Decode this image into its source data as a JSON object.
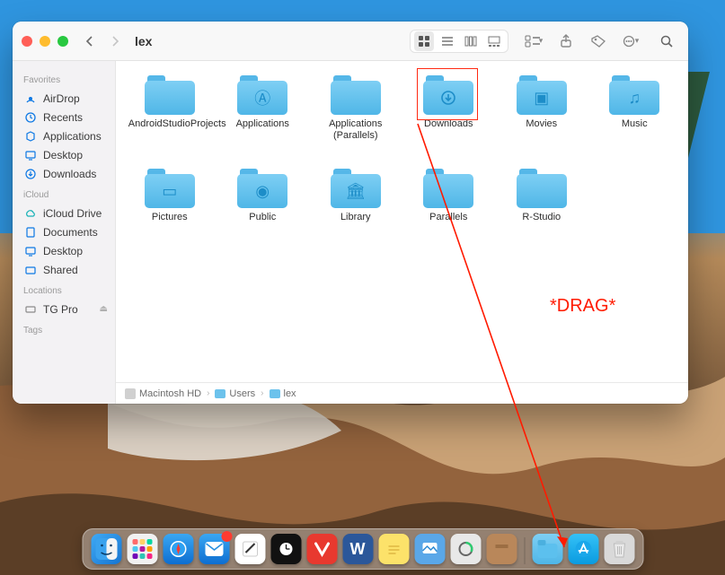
{
  "window": {
    "title": "lex"
  },
  "toolbar": {
    "view_icon_active": "icon",
    "group_label": "Group",
    "share_label": "Share",
    "tags_label": "Tags",
    "more_label": "More",
    "search_label": "Search"
  },
  "sidebar": {
    "sections": [
      {
        "header": "Favorites",
        "items": [
          {
            "label": "AirDrop",
            "icon": "airdrop"
          },
          {
            "label": "Recents",
            "icon": "clock"
          },
          {
            "label": "Applications",
            "icon": "apps"
          },
          {
            "label": "Desktop",
            "icon": "desktop"
          },
          {
            "label": "Downloads",
            "icon": "download"
          }
        ]
      },
      {
        "header": "iCloud",
        "items": [
          {
            "label": "iCloud Drive",
            "icon": "cloud"
          },
          {
            "label": "Documents",
            "icon": "doc"
          },
          {
            "label": "Desktop",
            "icon": "desktop"
          },
          {
            "label": "Shared",
            "icon": "shared"
          }
        ]
      },
      {
        "header": "Locations",
        "items": [
          {
            "label": "TG Pro",
            "icon": "disk",
            "eject": true
          }
        ]
      },
      {
        "header": "Tags",
        "items": []
      }
    ]
  },
  "folders": [
    {
      "label": "AndroidStudioProjects",
      "glyph": ""
    },
    {
      "label": "Applications",
      "glyph": "A"
    },
    {
      "label": "Applications (Parallels)",
      "glyph": ""
    },
    {
      "label": "Downloads",
      "glyph": "↓",
      "highlight": true
    },
    {
      "label": "Movies",
      "glyph": "▷"
    },
    {
      "label": "Music",
      "glyph": "♫"
    },
    {
      "label": "Pictures",
      "glyph": "▣"
    },
    {
      "label": "Public",
      "glyph": "◉"
    },
    {
      "label": "Library",
      "glyph": "🏛"
    },
    {
      "label": "Parallels",
      "glyph": ""
    },
    {
      "label": "R-Studio",
      "glyph": ""
    }
  ],
  "pathbar": {
    "segments": [
      {
        "label": "Macintosh HD",
        "type": "hdd"
      },
      {
        "label": "Users",
        "type": "folder"
      },
      {
        "label": "lex",
        "type": "folder"
      }
    ]
  },
  "dock": {
    "apps": [
      {
        "name": "Finder",
        "class": "d-finder"
      },
      {
        "name": "Launchpad",
        "class": "d-launchpad"
      },
      {
        "name": "Safari",
        "class": "d-safari"
      },
      {
        "name": "Mail",
        "class": "d-mail"
      },
      {
        "name": "TextEdit",
        "class": "d-edit"
      },
      {
        "name": "Clock",
        "class": "d-clock"
      },
      {
        "name": "Vivaldi",
        "class": "d-vivaldi"
      },
      {
        "name": "Word",
        "class": "d-word"
      },
      {
        "name": "Notes",
        "class": "d-notes"
      },
      {
        "name": "Preview",
        "class": "d-preview"
      },
      {
        "name": "Activity Monitor",
        "class": "d-activity"
      },
      {
        "name": "Package",
        "class": "d-pkg"
      }
    ],
    "right": [
      {
        "name": "Downloads",
        "class": "d-fold"
      },
      {
        "name": "App Store",
        "class": "d-store"
      },
      {
        "name": "Trash",
        "class": "d-trash"
      }
    ]
  },
  "annotation": {
    "label": "*DRAG*",
    "color": "#ff1a00",
    "from": "Downloads folder",
    "to": "Dock"
  }
}
